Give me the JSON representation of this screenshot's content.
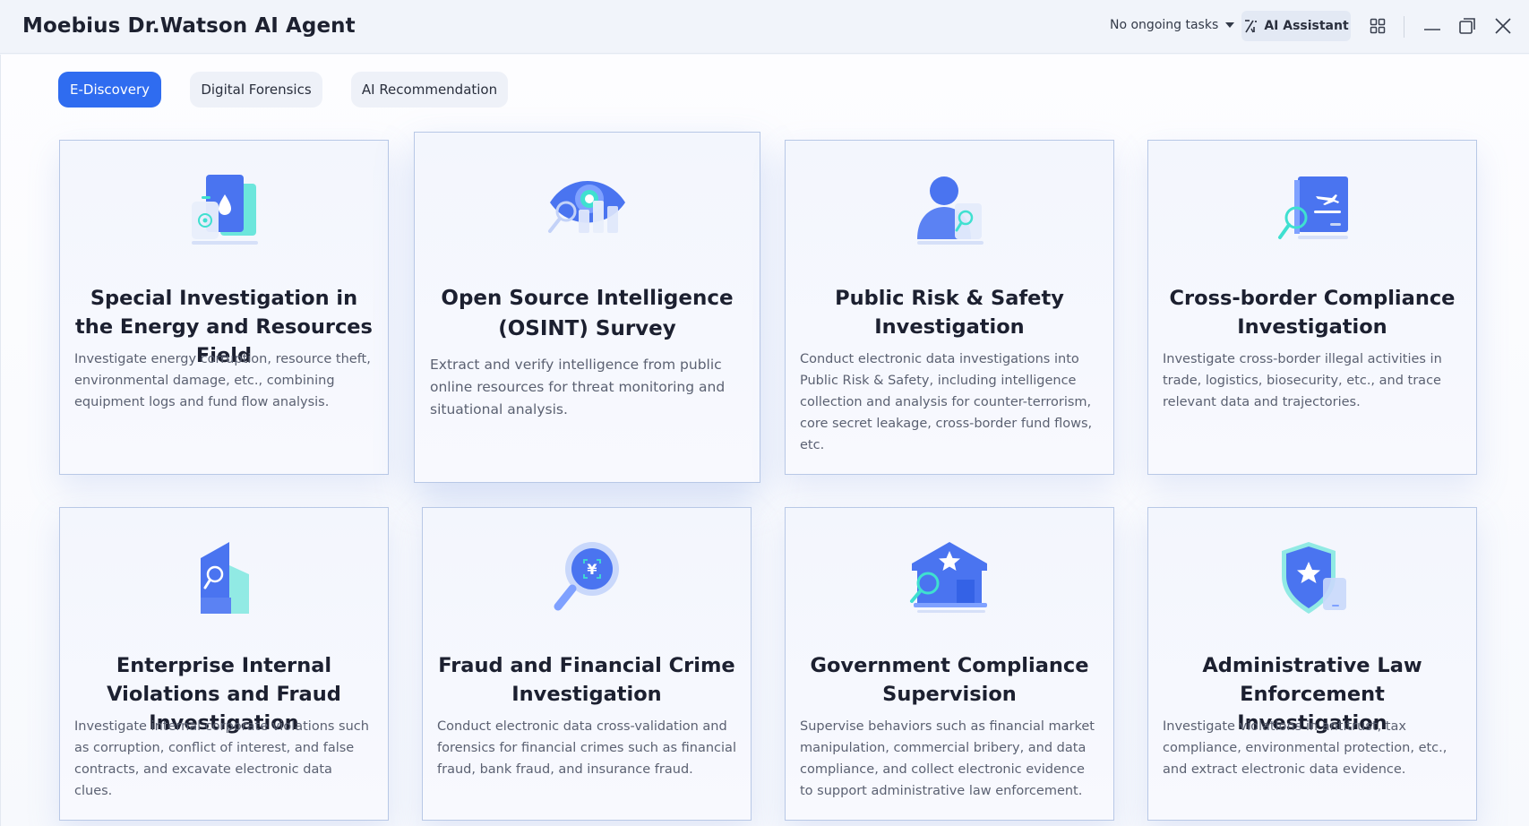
{
  "app": {
    "title": "Moebius Dr.Watson AI Agent"
  },
  "toolbar": {
    "tasks_label": "No ongoing tasks",
    "ai_assistant_label": "AI Assistant"
  },
  "tabs": [
    {
      "label": "E-Discovery",
      "active": true
    },
    {
      "label": "Digital Forensics",
      "active": false
    },
    {
      "label": "AI Recommendation",
      "active": false
    }
  ],
  "cards": [
    {
      "title": "Special Investigation in the Energy and Resources Field",
      "description": "Investigate energy corruption, resource theft, environmental damage, etc., combining equipment logs and fund flow analysis.",
      "icon": "energy-document-icon"
    },
    {
      "title": "Open Source Intelligence (OSINT) Survey",
      "description": "Extract and verify intelligence from public online resources for threat monitoring and situational analysis.",
      "icon": "eye-search-icon"
    },
    {
      "title": "Public Risk & Safety Investigation",
      "description": "Conduct electronic data investigations into Public Risk & Safety, including intelligence collection and analysis for counter-terrorism, core secret leakage, cross-border fund flows, etc.",
      "icon": "person-search-icon"
    },
    {
      "title": "Cross-border Compliance Investigation",
      "description": "Investigate cross-border illegal activities in trade, logistics, biosecurity, etc., and trace relevant data and trajectories.",
      "icon": "flight-document-icon"
    },
    {
      "title": "Enterprise Internal Violations and Fraud Investigation",
      "description": "Investigate internal corporate violations such as corruption, conflict of interest, and false contracts, and excavate electronic data clues.",
      "icon": "building-search-icon"
    },
    {
      "title": "Fraud and Financial Crime Investigation",
      "description": "Conduct electronic data cross-validation and forensics for financial crimes such as financial fraud, bank fraud, and insurance fraud.",
      "icon": "yuan-magnifier-icon"
    },
    {
      "title": "Government Compliance Supervision",
      "description": "Supervise behaviors such as financial market manipulation, commercial bribery, and data compliance, and collect electronic evidence to support administrative law enforcement.",
      "icon": "government-star-icon"
    },
    {
      "title": "Administrative Law Enforcement Investigation",
      "description": "Investigate violations in antitrust, tax compliance, environmental protection, etc., and extract electronic data evidence.",
      "icon": "shield-star-icon"
    }
  ],
  "colors": {
    "accent": "#2f6cf0",
    "icon_blue": "#4a74f0",
    "icon_teal": "#3fe0d0"
  }
}
